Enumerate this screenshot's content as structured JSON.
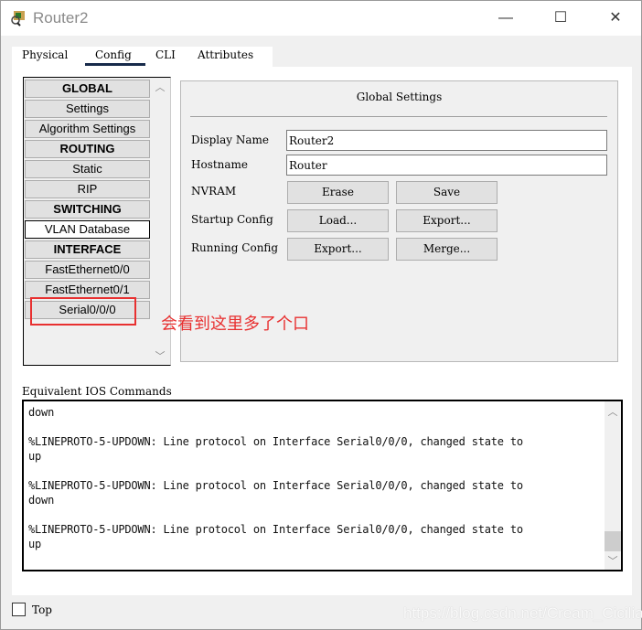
{
  "window": {
    "title": "Router2",
    "minimize": "—",
    "maximize": "☐",
    "close": "✕"
  },
  "tabs": [
    "Physical",
    "Config",
    "CLI",
    "Attributes"
  ],
  "active_tab": "Config",
  "sidebar": {
    "items": [
      {
        "label": "GLOBAL",
        "header": true
      },
      {
        "label": "Settings"
      },
      {
        "label": "Algorithm Settings"
      },
      {
        "label": "ROUTING",
        "header": true
      },
      {
        "label": "Static"
      },
      {
        "label": "RIP"
      },
      {
        "label": "SWITCHING",
        "header": true
      },
      {
        "label": "VLAN Database",
        "selected": true
      },
      {
        "label": "INTERFACE",
        "header": true
      },
      {
        "label": "FastEthernet0/0"
      },
      {
        "label": "FastEthernet0/1"
      },
      {
        "label": "Serial0/0/0"
      }
    ]
  },
  "global_settings": {
    "title": "Global Settings",
    "display_name_label": "Display Name",
    "display_name": "Router2",
    "hostname_label": "Hostname",
    "hostname": "Router",
    "nvram_label": "NVRAM",
    "erase": "Erase",
    "save": "Save",
    "startup_label": "Startup Config",
    "load": "Load...",
    "export_startup": "Export...",
    "running_label": "Running Config",
    "export_running": "Export...",
    "merge": "Merge..."
  },
  "console": {
    "label": "Equivalent IOS Commands",
    "lines": [
      "down",
      "",
      "%LINEPROTO-5-UPDOWN: Line protocol on Interface Serial0/0/0, changed state to",
      "up",
      "",
      "%LINEPROTO-5-UPDOWN: Line protocol on Interface Serial0/0/0, changed state to",
      "down",
      "",
      "%LINEPROTO-5-UPDOWN: Line protocol on Interface Serial0/0/0, changed state to",
      "up"
    ]
  },
  "top_checkbox": {
    "label": "Top",
    "checked": false
  },
  "annotation": {
    "text": "会看到这里多了个口",
    "color": "#e83030"
  },
  "watermark": "https://blog.csdn.net/Cream_Cicilian"
}
